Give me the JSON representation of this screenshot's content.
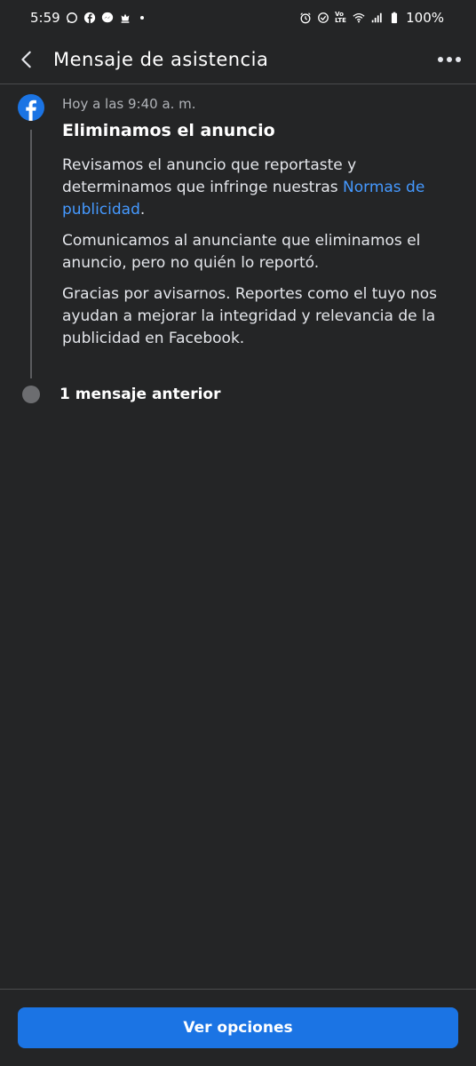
{
  "status_bar": {
    "time": "5:59",
    "battery": "100%",
    "left_icons": [
      "whatsapp-icon",
      "facebook-icon",
      "messenger-icon",
      "chess-icon"
    ],
    "right_icons": [
      "alarm-icon",
      "sync-icon",
      "volte-icon",
      "wifi-icon",
      "signal-icon",
      "battery-icon"
    ],
    "volte_text": "Vo LTE"
  },
  "header": {
    "title": "Mensaje de asistencia"
  },
  "message": {
    "timestamp": "Hoy a las 9:40 a. m.",
    "title": "Eliminamos el anuncio",
    "para1_before": "Revisamos el anuncio que reportaste y determinamos que infringe nuestras ",
    "para1_link": "Normas de publicidad",
    "para1_after": ".",
    "para2": "Comunicamos al anunciante que eliminamos el anuncio, pero no quién lo reportó.",
    "para3": "Gracias por avisarnos. Reportes como el tuyo nos ayudan a mejorar la integridad y relevancia de la publicidad en Facebook."
  },
  "previous": {
    "label": "1 mensaje anterior"
  },
  "footer": {
    "button_label": "Ver opciones"
  },
  "colors": {
    "background": "#242526",
    "accent": "#1b74e4",
    "link": "#4599ff"
  }
}
